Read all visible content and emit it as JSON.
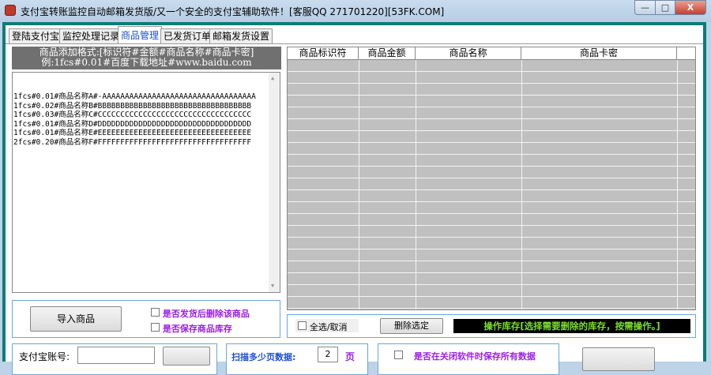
{
  "window": {
    "title": "支付宝转账监控自动邮箱发货版/又一个安全的支付宝辅助软件！[客服QQ 271701220][53FK.COM]",
    "minimize": "—",
    "maximize": "□",
    "close": "X"
  },
  "tabs": [
    {
      "label": "登陆支付宝"
    },
    {
      "label": "监控处理记录"
    },
    {
      "label": "商品管理"
    },
    {
      "label": "已发货订单"
    },
    {
      "label": "邮箱发货设置"
    }
  ],
  "format_hint": {
    "line1": "商品添加格式:[标识符#金额#商品名称#商品卡密]",
    "line2": "例:1fcs#0.01#百度下载地址#www.baidu.com"
  },
  "editor_text": "1fcs#0.01#商品名称A#-AAAAAAAAAAAAAAAAAAAAAAAAAAAAAAAAAA\n1fcs#0.02#商品名称B#BBBBBBBBBBBBBBBBBBBBBBBBBBBBBBBBBB\n1fcs#0.03#商品名称C#CCCCCCCCCCCCCCCCCCCCCCCCCCCCCCCCCC\n1fcs#0.01#商品名称D#DDDDDDDDDDDDDDDDDDDDDDDDDDDDDDDDDD\n1fcs#0.01#商品名称E#EEEEEEEEEEEEEEEEEEEEEEEEEEEEEEEEEE\n2fcs#0.20#商品名称F#FFFFFFFFFFFFFFFFFFFFFFFFFFFFFFFFFF",
  "import": {
    "button": "导入商品",
    "opt_delete": "是否发货后删除该商品",
    "opt_save": "是否保存商品库存"
  },
  "grid": {
    "columns": [
      "商品标识符",
      "商品金额",
      "商品名称",
      "商品卡密"
    ]
  },
  "grid_actions": {
    "select_all": "全选/取消",
    "delete": "删除选定",
    "status": "操作库存[选择需要删除的库存，按需操作。]"
  },
  "bottom": {
    "account_label": "支付宝账号:",
    "account_value": "",
    "scan_label": "扫描多少页数据:",
    "scan_value": "2",
    "scan_unit": "页",
    "save_all": "是否在关闭软件时保存所有数据"
  }
}
